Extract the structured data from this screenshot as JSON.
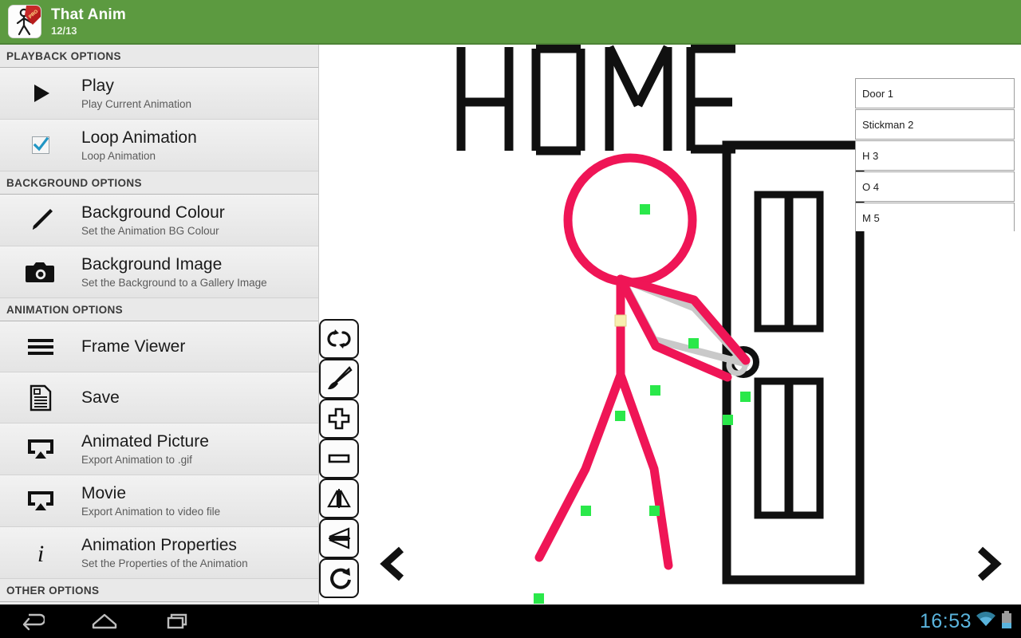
{
  "header": {
    "title": "That Anim",
    "frame_counter": "12/13",
    "bg_color": "#5c9a40",
    "app_icon": "stickman-pro-icon"
  },
  "sidebar": {
    "sections": [
      {
        "label": "PLAYBACK OPTIONS",
        "items": [
          {
            "icon": "play-icon",
            "title": "Play",
            "subtitle": "Play Current Animation",
            "checked": null
          },
          {
            "icon": "checkbox-icon",
            "title": "Loop Animation",
            "subtitle": "Loop Animation",
            "checked": true
          }
        ]
      },
      {
        "label": "BACKGROUND OPTIONS",
        "items": [
          {
            "icon": "brush-icon",
            "title": "Background Colour",
            "subtitle": "Set the Animation BG Colour",
            "checked": null
          },
          {
            "icon": "camera-icon",
            "title": "Background Image",
            "subtitle": "Set the Background to a Gallery Image",
            "checked": null
          }
        ]
      },
      {
        "label": "ANIMATION OPTIONS",
        "items": [
          {
            "icon": "hamburger-icon",
            "title": "Frame Viewer",
            "subtitle": "",
            "checked": null
          },
          {
            "icon": "document-icon",
            "title": "Save",
            "subtitle": "",
            "checked": null
          },
          {
            "icon": "screencast-icon",
            "title": "Animated Picture",
            "subtitle": "Export Animation to .gif",
            "checked": null
          },
          {
            "icon": "screencast-icon",
            "title": "Movie",
            "subtitle": "Export Animation to video file",
            "checked": null
          },
          {
            "icon": "info-icon",
            "title": "Animation Properties",
            "subtitle": "Set the Properties of the Animation",
            "checked": null
          }
        ]
      },
      {
        "label": "OTHER OPTIONS",
        "items": []
      }
    ]
  },
  "toolstrip": {
    "buttons": [
      {
        "name": "undo-redo-icon",
        "label": "Undo / Redo"
      },
      {
        "name": "brush-tool-icon",
        "label": "Brush"
      },
      {
        "name": "plus-icon",
        "label": "Zoom In"
      },
      {
        "name": "minus-icon",
        "label": "Zoom Out"
      },
      {
        "name": "flip-horizontal-icon",
        "label": "Flip Horizontal"
      },
      {
        "name": "flip-vertical-icon",
        "label": "Flip Vertical"
      },
      {
        "name": "rotate-icon",
        "label": "Rotate"
      }
    ]
  },
  "layer_list": {
    "items": [
      {
        "label": "Door 1"
      },
      {
        "label": "Stickman 2"
      },
      {
        "label": "H 3"
      },
      {
        "label": "O 4"
      },
      {
        "label": "M 5"
      },
      {
        "label": ""
      }
    ]
  },
  "canvas": {
    "background": "#ffffff",
    "drawing_text": "HOME",
    "stroke_color": "#ef1556",
    "joint_color": "#2ae84a",
    "selected_joint_color": "#f7eeb0",
    "ghost_color": "#c9c9c9",
    "object_color": "#101010",
    "nav_prev": "chevron-left",
    "nav_next": "chevron-right"
  },
  "system_bar": {
    "clock": "16:53",
    "nav": [
      {
        "name": "back-icon"
      },
      {
        "name": "home-icon"
      },
      {
        "name": "recents-icon"
      }
    ],
    "status": [
      {
        "name": "wifi-icon"
      },
      {
        "name": "battery-icon"
      }
    ],
    "accent_color": "#5ab4dd"
  }
}
